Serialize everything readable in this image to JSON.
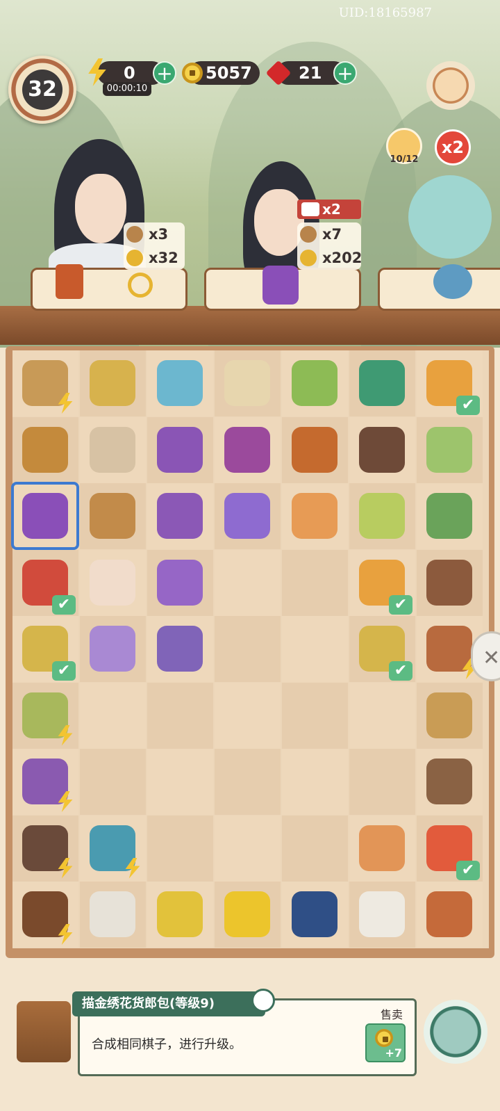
{
  "uid": "UID:18165987",
  "player": {
    "level": "32"
  },
  "currencies": {
    "energy": {
      "value": "0",
      "timer": "00:00:10"
    },
    "coins": {
      "value": "5057"
    },
    "gems": {
      "value": "21"
    }
  },
  "side_badges": {
    "cat_count": "10/12",
    "multiplier": "x2"
  },
  "customers": [
    {
      "req_a": "x3",
      "req_b": "x32"
    },
    {
      "bonus": "x2",
      "req_a": "x7",
      "req_b": "x202"
    }
  ],
  "board": {
    "cols": 7,
    "rows": 9,
    "items": [
      {
        "r": 0,
        "c": 0,
        "name": "scroll-toolbox-generator",
        "color": "#c89a57",
        "bolt": true
      },
      {
        "r": 0,
        "c": 1,
        "name": "wheat-bundle",
        "color": "#d7b24d"
      },
      {
        "r": 0,
        "c": 2,
        "name": "jade-disc",
        "color": "#6cb7cf"
      },
      {
        "r": 0,
        "c": 3,
        "name": "tea-bowl",
        "color": "#e7d6ae"
      },
      {
        "r": 0,
        "c": 4,
        "name": "bamboo",
        "color": "#8dbb55"
      },
      {
        "r": 0,
        "c": 5,
        "name": "green-gourd",
        "color": "#3f9a73"
      },
      {
        "r": 0,
        "c": 6,
        "name": "fried-rice-plate",
        "color": "#e8a13e",
        "check": true
      },
      {
        "r": 1,
        "c": 0,
        "name": "wooden-toolbox",
        "color": "#c48a3c"
      },
      {
        "r": 1,
        "c": 1,
        "name": "thread-spindle",
        "color": "#d7c2a4"
      },
      {
        "r": 1,
        "c": 2,
        "name": "embroidered-bag",
        "color": "#8a55b5"
      },
      {
        "r": 1,
        "c": 3,
        "name": "embroidered-bag",
        "color": "#9b4a9c"
      },
      {
        "r": 1,
        "c": 4,
        "name": "roast-chicken-bowl",
        "color": "#c56a2e"
      },
      {
        "r": 1,
        "c": 5,
        "name": "dark-chest",
        "color": "#6e4a38"
      },
      {
        "r": 1,
        "c": 6,
        "name": "green-soup",
        "color": "#9dc46c"
      },
      {
        "r": 2,
        "c": 0,
        "name": "embroidered-handbag",
        "color": "#8a4fb8",
        "selected": true
      },
      {
        "r": 2,
        "c": 1,
        "name": "water-bucket",
        "color": "#c28b4a"
      },
      {
        "r": 2,
        "c": 2,
        "name": "pouch-bag",
        "color": "#8b58b6"
      },
      {
        "r": 2,
        "c": 3,
        "name": "purple-pouch",
        "color": "#8e6bd0"
      },
      {
        "r": 2,
        "c": 4,
        "name": "paper-lantern",
        "color": "#e79b55"
      },
      {
        "r": 2,
        "c": 5,
        "name": "bamboo-strips",
        "color": "#b8cc60"
      },
      {
        "r": 2,
        "c": 6,
        "name": "scissors",
        "color": "#6aa35a"
      },
      {
        "r": 3,
        "c": 0,
        "name": "watermelon-board",
        "color": "#d14b3c",
        "check": true
      },
      {
        "r": 3,
        "c": 1,
        "name": "peach-bun",
        "color": "#f1dccb"
      },
      {
        "r": 3,
        "c": 2,
        "name": "purple-purse",
        "color": "#9666c6"
      },
      {
        "r": 3,
        "c": 5,
        "name": "fried-rice-plate",
        "color": "#e8a13e",
        "check": true
      },
      {
        "r": 3,
        "c": 6,
        "name": "bird-nest",
        "color": "#8c5a3d"
      },
      {
        "r": 4,
        "c": 0,
        "name": "rice-bowl",
        "color": "#d5b54b",
        "check": true
      },
      {
        "r": 4,
        "c": 1,
        "name": "folded-cloth",
        "color": "#a989d3"
      },
      {
        "r": 4,
        "c": 2,
        "name": "embroidery-hoop",
        "color": "#8064b8"
      },
      {
        "r": 4,
        "c": 5,
        "name": "rice-bowl",
        "color": "#d5b54b",
        "check": true
      },
      {
        "r": 4,
        "c": 6,
        "name": "clay-gourd",
        "color": "#b86a3e",
        "bolt": true
      },
      {
        "r": 5,
        "c": 0,
        "name": "fruit-basket-generator",
        "color": "#a8b85c",
        "bolt": true
      },
      {
        "r": 5,
        "c": 6,
        "name": "brush",
        "color": "#c99c55"
      },
      {
        "r": 6,
        "c": 0,
        "name": "spinning-wheel",
        "color": "#8a5ab0",
        "bolt": true
      },
      {
        "r": 6,
        "c": 6,
        "name": "sparrow",
        "color": "#8a6244"
      },
      {
        "r": 7,
        "c": 0,
        "name": "treasure-chest",
        "color": "#6a4a3a",
        "bolt": true
      },
      {
        "r": 7,
        "c": 1,
        "name": "teapot-set",
        "color": "#4a9bb0",
        "bolt": true
      },
      {
        "r": 7,
        "c": 5,
        "name": "egg",
        "color": "#e29557"
      },
      {
        "r": 7,
        "c": 6,
        "name": "fruit-platter",
        "color": "#e25b3c",
        "check": true
      },
      {
        "r": 8,
        "c": 0,
        "name": "branch-ring",
        "color": "#7a4a2c",
        "bolt": true
      },
      {
        "r": 8,
        "c": 1,
        "name": "silk-cocoons",
        "color": "#e7e2d8"
      },
      {
        "r": 8,
        "c": 2,
        "name": "yellow-bird",
        "color": "#e2c23b"
      },
      {
        "r": 8,
        "c": 3,
        "name": "oriole",
        "color": "#ecc52c"
      },
      {
        "r": 8,
        "c": 4,
        "name": "magpie",
        "color": "#2f4f86"
      },
      {
        "r": 8,
        "c": 5,
        "name": "cotton",
        "color": "#eeeae1"
      },
      {
        "r": 8,
        "c": 6,
        "name": "chicken-coop",
        "color": "#c56a3a"
      }
    ]
  },
  "info": {
    "title": "描金绣花货郎包(等级9)",
    "description": "合成相同棋子，进行升级。",
    "sell_label": "售卖",
    "sell_value": "+7"
  }
}
